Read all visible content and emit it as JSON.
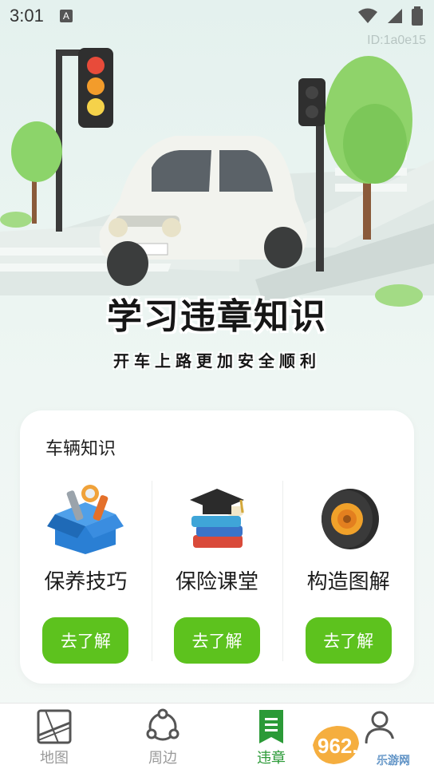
{
  "status_bar": {
    "time": "3:01",
    "notification_letter": "A"
  },
  "id_label": "ID:1a0e15",
  "hero": {
    "title": "学习违章知识",
    "subtitle": "开车上路更加安全顺利"
  },
  "card": {
    "title": "车辆知识",
    "items": [
      {
        "name": "保养技巧",
        "button": "去了解",
        "icon": "toolbox-icon"
      },
      {
        "name": "保险课堂",
        "button": "去了解",
        "icon": "books-graduation-cap-icon"
      },
      {
        "name": "构造图解",
        "button": "去了解",
        "icon": "tire-icon"
      }
    ]
  },
  "tabbar": {
    "active": "违章",
    "tabs": [
      {
        "label": "地图",
        "icon": "map-icon"
      },
      {
        "label": "周边",
        "icon": "nearby-icon"
      },
      {
        "label": "违章",
        "icon": "violation-icon"
      },
      {
        "label": "",
        "icon": "profile-icon"
      }
    ]
  },
  "watermark": {
    "brand": "962.NET",
    "site": "乐游网"
  },
  "colors": {
    "accent_green": "#5dc21e",
    "active_tab": "#2b9a37",
    "background": "#e4f1ee"
  }
}
